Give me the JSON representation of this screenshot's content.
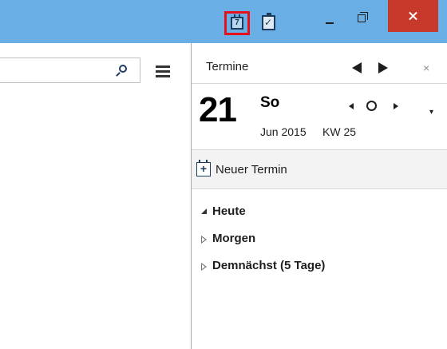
{
  "titlebar": {
    "calendar_icon_day": "7",
    "colors": {
      "bar": "#6aaee6",
      "close": "#c7392b",
      "highlight": "#e8101a"
    }
  },
  "left": {
    "search_placeholder": ""
  },
  "sidebar": {
    "title": "Termine",
    "close_glyph": "×",
    "day_number": "21",
    "weekday": "So",
    "month_year": "Jun 2015",
    "week": "KW 25",
    "new_event_label": "Neuer Termin",
    "agenda": [
      {
        "label": "Heute",
        "expanded": true
      },
      {
        "label": "Morgen",
        "expanded": false
      },
      {
        "label": "Demnächst (5 Tage)",
        "expanded": false
      }
    ]
  }
}
